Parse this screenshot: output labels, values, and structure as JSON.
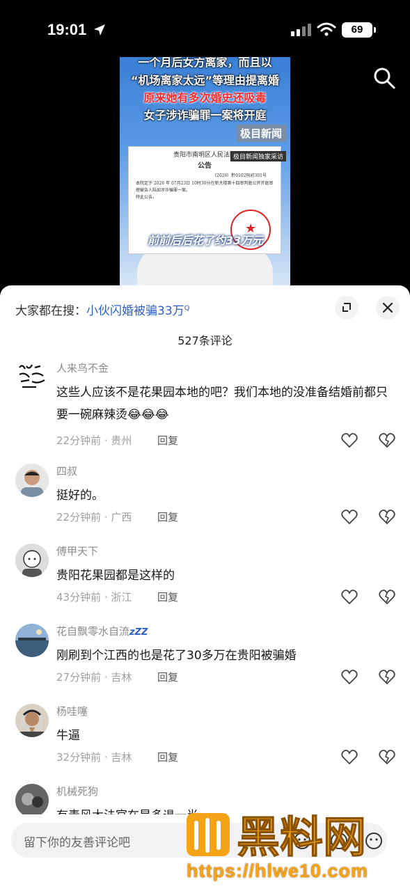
{
  "status": {
    "time": "19:01",
    "battery": "69"
  },
  "video": {
    "lines": [
      {
        "text": "一个月后女方离家，而且以",
        "color": "white"
      },
      {
        "text": "“机场离家太远”等理由提离婚",
        "color": "white"
      },
      {
        "text": "原来她有多次婚史还吸毒",
        "color": "red"
      },
      {
        "text": "女子涉诈骗罪一案将开庭",
        "color": "white"
      }
    ],
    "news_logo": "极目新闻",
    "news_sub": "极目新闻独家采访",
    "notice": {
      "court": "贵阳市南明区人民法院",
      "title": "公告",
      "number": "（2026）黔0102刑初301号",
      "body": "本院定于 2026 年 07月23日 10时30分在新大楼第十四审判庭公开开庭审理被告人陆如涉诈骗罪一案。",
      "ending": "特此公告。"
    },
    "caption": "前前后后花了约33万元"
  },
  "sheet": {
    "trend_prefix": "大家都在搜：",
    "trend_keyword": "小伙闪婚被骗33万",
    "trend_icon": "Q",
    "comment_count": "527条评论",
    "reply_label": "回复",
    "comments": [
      {
        "user": "人来鸟不金",
        "text": "这些人应该不是花果园本地的吧？我们本地的没准备结婚前都只要一碗麻辣烫😂😂😂",
        "meta": "22分钟前 · 贵州",
        "avatar": "calligraphy"
      },
      {
        "user": "四叔",
        "text": "挺好的。",
        "meta": "22分钟前 · 广西",
        "avatar": "man"
      },
      {
        "user": "傅甲天下",
        "text": "贵阳花果园都是这样的",
        "meta": "43分钟前 · 浙江",
        "avatar": "sketch"
      },
      {
        "user": "花自飘零水自流",
        "user_badge": "zZZ",
        "text": "刚刷到个江西的也是花了30多万在贵阳被骗婚",
        "meta": "27分钟前 · 吉林",
        "avatar": "lake"
      },
      {
        "user": "杨哇噻",
        "text": "牛逼",
        "meta": "32分钟前 · 吉林",
        "avatar": "praying"
      },
      {
        "user": "机械死狗",
        "text": "有毒风太法官在是多退一半",
        "meta": "",
        "avatar": "bw"
      }
    ],
    "input_placeholder": "留下你的友善评论吧"
  },
  "watermark": {
    "logo_text": "黑料网",
    "url": "https://hlwe10.com"
  },
  "icons": [
    "location-arrow-icon",
    "signal-icon",
    "wifi-icon",
    "search-icon",
    "expand-icon",
    "close-icon",
    "like-icon",
    "dislike-icon",
    "emoji-icon"
  ],
  "colors": {
    "keyword": "#2c5fc4",
    "watermark": "#f5a316",
    "red_text": "#ff2a2a"
  }
}
